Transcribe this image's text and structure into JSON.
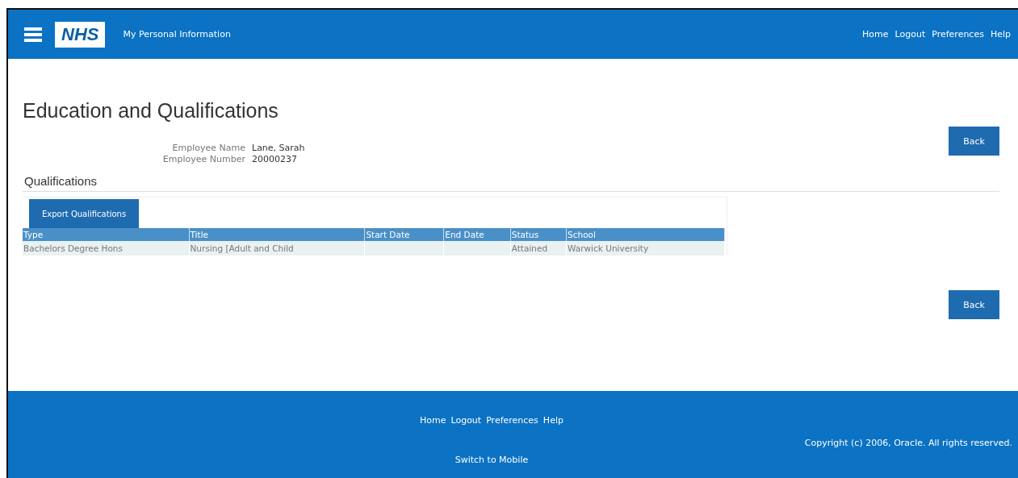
{
  "header": {
    "logo": "NHS",
    "app_title": "My Personal Information",
    "links": [
      "Home",
      "Logout",
      "Preferences",
      "Help"
    ]
  },
  "page": {
    "title": "Education and Qualifications",
    "back_button": "Back",
    "fields": [
      {
        "label": "Employee Name",
        "value": "Lane, Sarah"
      },
      {
        "label": "Employee Number",
        "value": "20000237"
      }
    ],
    "section_title": "Qualifications",
    "export_button": "Export Qualifications",
    "table": {
      "columns": [
        "Type",
        "Title",
        "Start Date",
        "End Date",
        "Status",
        "School"
      ],
      "rows": [
        [
          "Bachelors Degree Hons",
          "Nursing [Adult and Child",
          "",
          "",
          "Attained",
          "Warwick University"
        ]
      ]
    },
    "bottom_back_button": "Back"
  },
  "footer": {
    "links": [
      "Home",
      "Logout",
      "Preferences",
      "Help"
    ],
    "mobile_link": "Switch to Mobile",
    "copyright": "Copyright (c) 2006, Oracle. All rights reserved."
  }
}
